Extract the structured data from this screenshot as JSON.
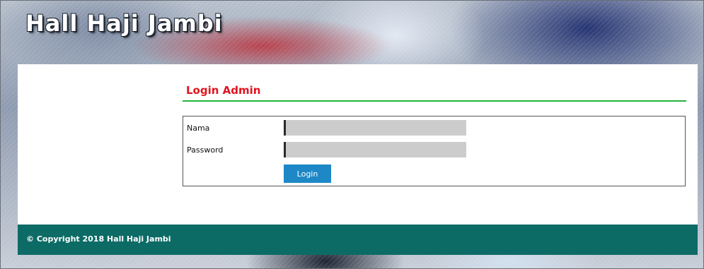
{
  "site": {
    "title": "Hall Haji Jambi"
  },
  "login": {
    "heading": "Login Admin",
    "fields": [
      {
        "label": "Nama",
        "value": ""
      },
      {
        "label": "Password",
        "value": ""
      }
    ],
    "button_label": "Login"
  },
  "footer": {
    "copyright": "© Copyright 2018 Hall Haji Jambi"
  },
  "colors": {
    "heading": "#e0141e",
    "divider": "#22b43a",
    "button": "#1e88c7",
    "footer": "#0d6b66",
    "input": "#cccccc"
  }
}
